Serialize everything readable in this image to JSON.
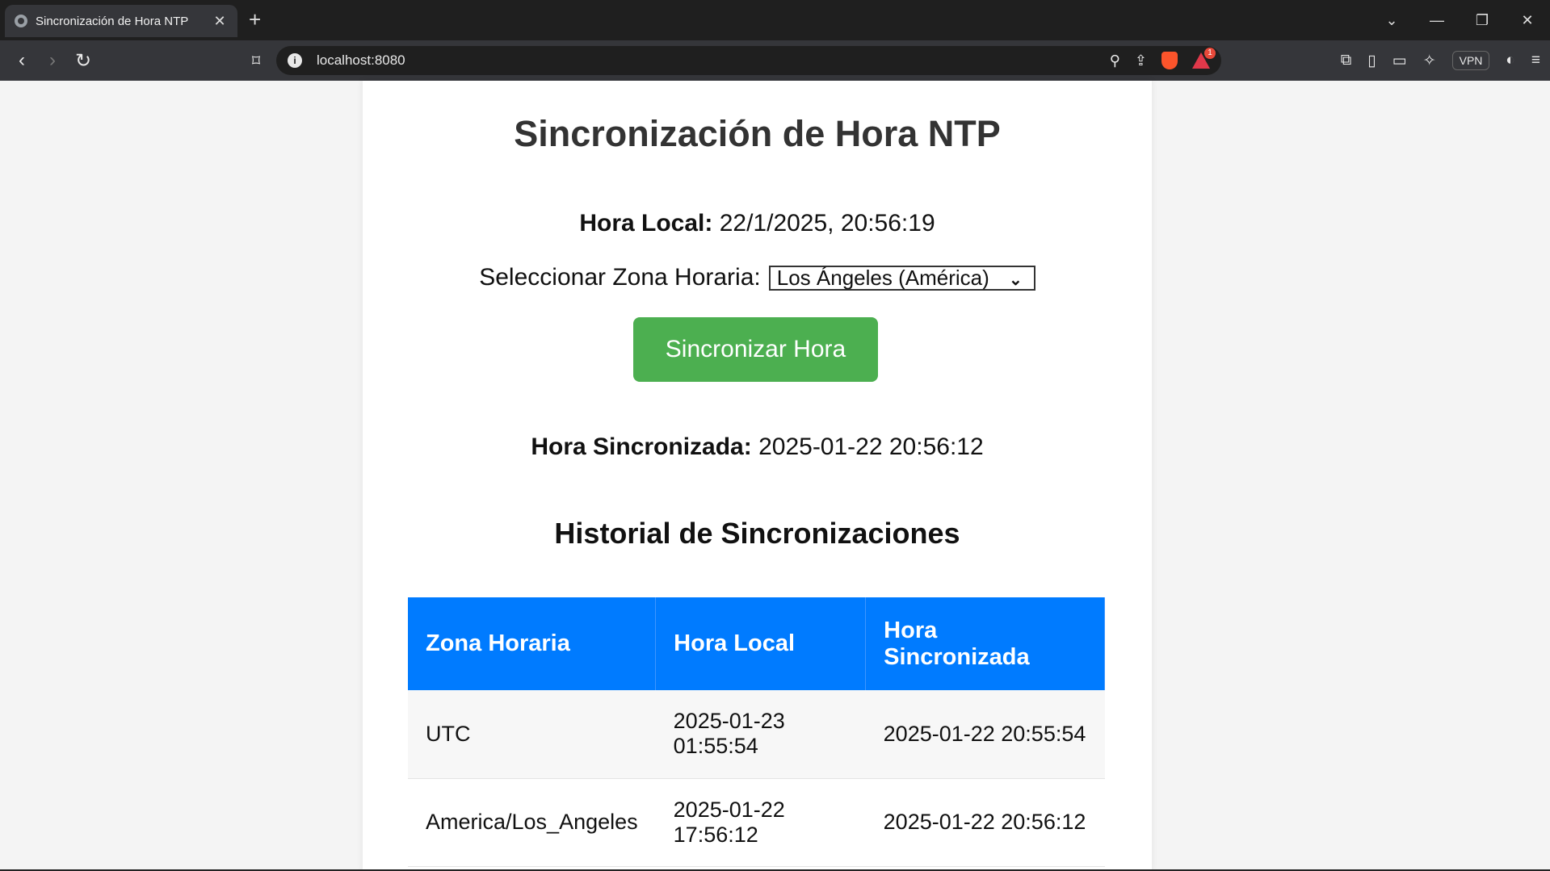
{
  "browser": {
    "tab_title": "Sincronización de Hora NTP",
    "url": "localhost:8080",
    "vpn_label": "VPN",
    "rewards_badge": "1"
  },
  "page": {
    "heading": "Sincronización de Hora NTP",
    "local_time_label": "Hora Local:",
    "local_time_value": "22/1/2025, 20:56:19",
    "timezone_label": "Seleccionar Zona Horaria:",
    "timezone_selected": "Los Ángeles (América)",
    "sync_button": "Sincronizar Hora",
    "synced_label": "Hora Sincronizada:",
    "synced_value": "2025-01-22 20:56:12",
    "history_heading": "Historial de Sincronizaciones",
    "table": {
      "headers": [
        "Zona Horaria",
        "Hora Local",
        "Hora Sincronizada"
      ],
      "rows": [
        [
          "UTC",
          "2025-01-23 01:55:54",
          "2025-01-22 20:55:54"
        ],
        [
          "America/Los_Angeles",
          "2025-01-22 17:56:12",
          "2025-01-22 20:56:12"
        ]
      ]
    }
  },
  "colors": {
    "button": "#4caf50",
    "table_header": "#007bff"
  }
}
